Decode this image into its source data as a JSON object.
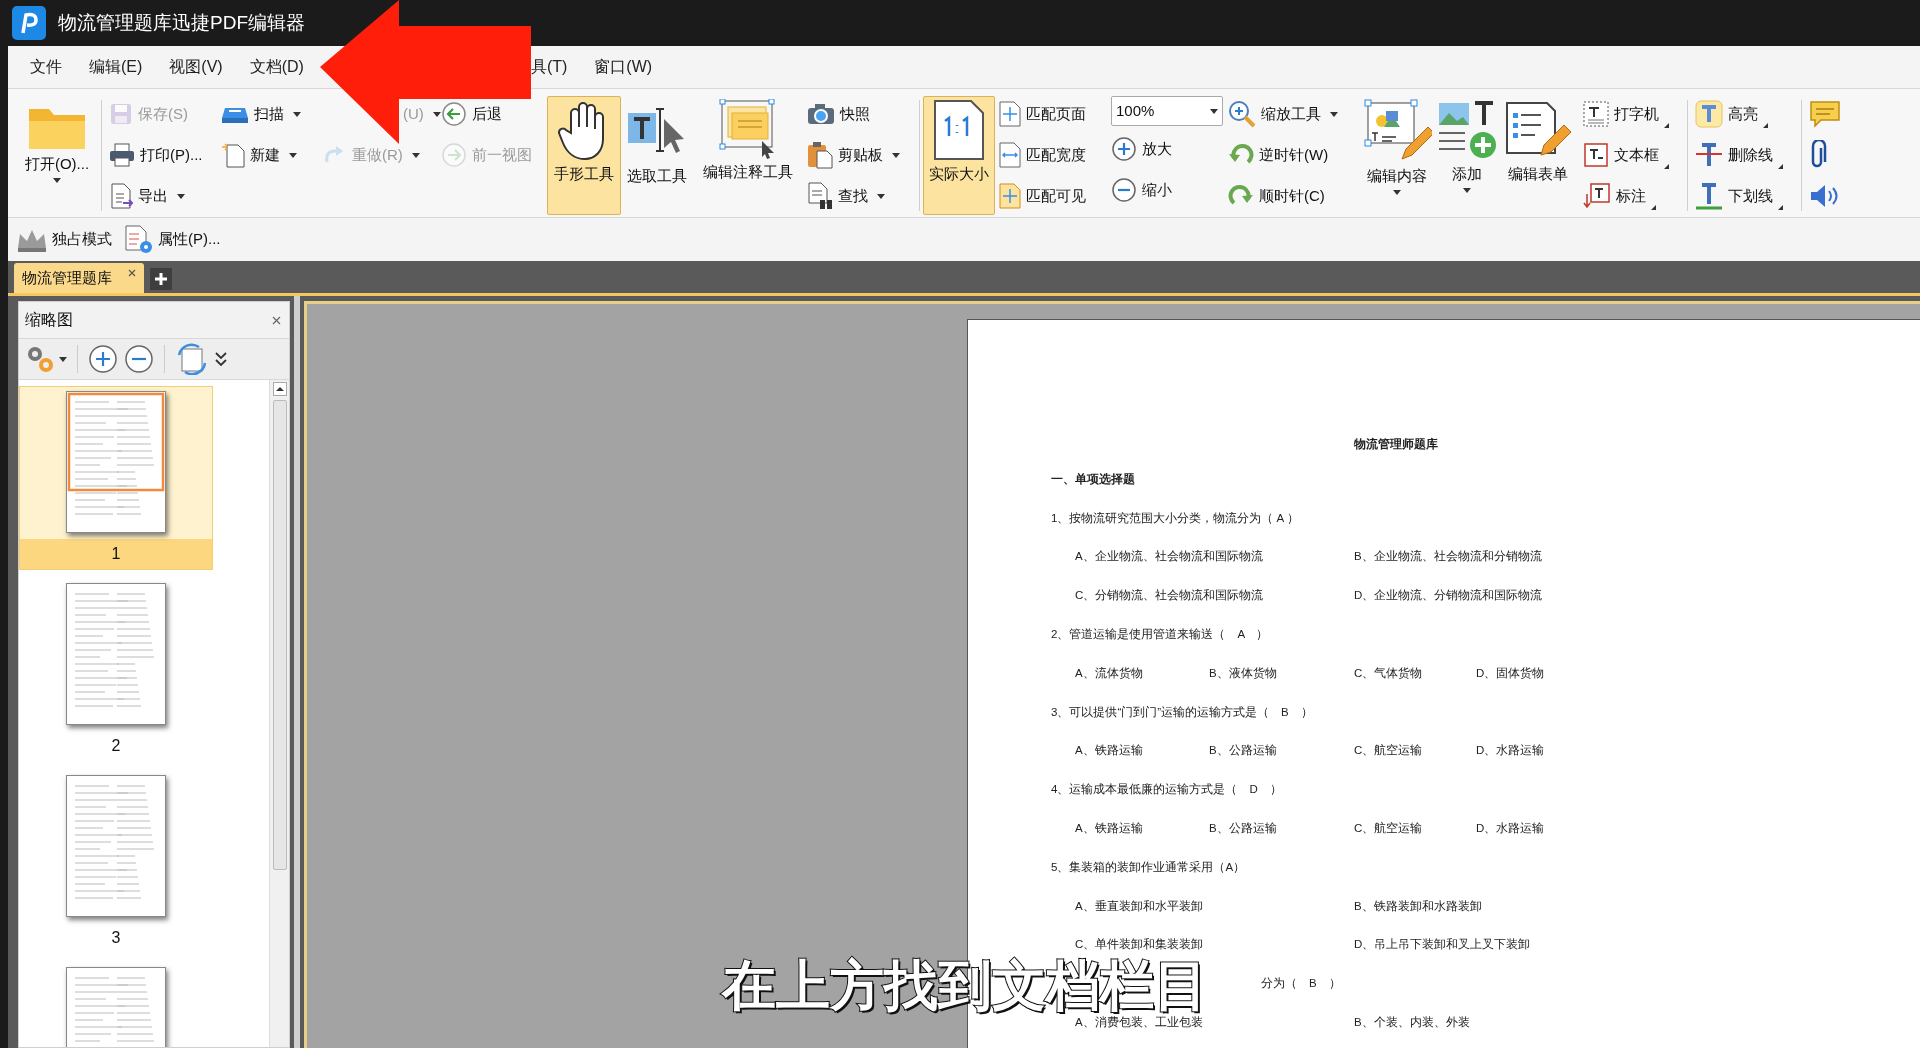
{
  "window": {
    "title": "物流管理题库迅捷PDF编辑器"
  },
  "menu": [
    {
      "label": "文件"
    },
    {
      "label": "编辑(E)"
    },
    {
      "label": "视图(V)"
    },
    {
      "label": "文档(D)"
    },
    {
      "label": "具(T)"
    },
    {
      "label": "窗口(W)"
    }
  ],
  "ribbon": {
    "columns": [
      {
        "kind": "large",
        "items": [
          {
            "label": "打开(O)...",
            "dropdown": true,
            "selected": false
          }
        ],
        "separator_after": true
      },
      {
        "kind": "stack",
        "items": [
          {
            "label": "保存(S)",
            "disabled": true
          },
          {
            "label": "打印(P)...",
            "disabled": false
          },
          {
            "label": "导出",
            "dropdown": true,
            "disabled": false
          }
        ]
      },
      {
        "kind": "stack",
        "items": [
          {
            "label": "扫描",
            "dropdown": true,
            "disabled": false
          },
          {
            "label": "新建",
            "dropdown": true,
            "disabled": false
          }
        ]
      },
      {
        "kind": "stack",
        "items": [
          {
            "kind": "text",
            "label": "(U)",
            "dropdown": true,
            "disabled": true
          },
          {
            "label": "重做(R)",
            "dropdown": true,
            "disabled": true
          }
        ]
      },
      {
        "kind": "stack",
        "items": [
          {
            "label": "后退",
            "disabled": false
          },
          {
            "label": "前一视图",
            "disabled": true
          }
        ]
      },
      {
        "kind": "large",
        "items": [
          {
            "label": "手形工具",
            "selected": true
          },
          {
            "label": "选取工具",
            "selected": false
          },
          {
            "label": "编辑注释工具",
            "selected": false
          }
        ]
      },
      {
        "kind": "stack",
        "items": [
          {
            "label": "快照",
            "disabled": false
          },
          {
            "label": "剪贴板",
            "dropdown": true,
            "disabled": false
          },
          {
            "label": "查找",
            "dropdown": true,
            "disabled": false
          }
        ],
        "separator_after": true
      },
      {
        "kind": "large",
        "items": [
          {
            "label": "实际大小",
            "selected": true
          }
        ]
      },
      {
        "kind": "stack",
        "items": [
          {
            "label": "匹配页面",
            "disabled": false
          },
          {
            "label": "匹配宽度",
            "disabled": false
          },
          {
            "label": "匹配可见",
            "disabled": false
          }
        ]
      },
      {
        "kind": "stack",
        "items": [
          {
            "kind": "select",
            "value": "100%"
          },
          {
            "label": "放大",
            "disabled": false
          },
          {
            "label": "缩小",
            "disabled": false
          }
        ]
      },
      {
        "kind": "stack",
        "items": [
          {
            "label": "缩放工具",
            "dropdown": true,
            "disabled": false
          },
          {
            "label": "逆时针(W)",
            "disabled": false
          },
          {
            "label": "顺时针(C)",
            "disabled": false
          }
        ]
      },
      {
        "kind": "large",
        "items": [
          {
            "label": "编辑内容",
            "dropdown": true,
            "selected": false
          },
          {
            "label": "添加",
            "dropdown": true,
            "selected": false
          },
          {
            "label": "编辑表单",
            "selected": false
          }
        ]
      },
      {
        "kind": "stack",
        "items": [
          {
            "label": "打字机",
            "submenu": true,
            "disabled": false
          },
          {
            "label": "文本框",
            "submenu": true,
            "disabled": false
          },
          {
            "label": "标注",
            "submenu": true,
            "disabled": false
          }
        ],
        "separator_after": true
      },
      {
        "kind": "stack",
        "items": [
          {
            "label": "高亮",
            "submenu": true,
            "disabled": false
          },
          {
            "label": "删除线",
            "submenu": true,
            "disabled": false
          },
          {
            "label": "下划线",
            "submenu": true,
            "disabled": false
          }
        ],
        "separator_after": true
      },
      {
        "kind": "stack",
        "items": [
          {
            "kind": "icon"
          },
          {
            "kind": "icon"
          },
          {
            "kind": "icon"
          }
        ]
      }
    ]
  },
  "quick_bar": [
    {
      "label": "独占模式"
    },
    {
      "label": "属性(P)..."
    }
  ],
  "tabs": [
    {
      "label": "物流管理题库",
      "selected": true
    }
  ],
  "thumbnails_panel": {
    "title": "缩略图",
    "pages": [
      {
        "label": "1",
        "selected": true
      },
      {
        "label": "2",
        "selected": false
      },
      {
        "label": "3",
        "selected": false
      },
      {
        "selected": false
      }
    ]
  },
  "document": {
    "title": "物流管理师题库",
    "lines": [
      {
        "kind": "heading",
        "text": "一、单项选择题"
      },
      {
        "kind": "question",
        "text": "1、按物流研究范围大小分类，物流分为（ A ）"
      },
      {
        "kind": "options",
        "items": [
          "A、企业物流、社会物流和国际物流",
          "B、企业物流、社会物流和分销物流"
        ]
      },
      {
        "kind": "options",
        "items": [
          "C、分销物流、社会物流和国际物流",
          "D、企业物流、分销物流和国际物流"
        ]
      },
      {
        "kind": "question",
        "text": "2、管道运输是使用管道来输送（　A　）"
      },
      {
        "kind": "options",
        "items": [
          "A、流体货物",
          "B、液体货物",
          "C、气体货物",
          "D、固体货物"
        ]
      },
      {
        "kind": "question",
        "text": "3、可以提供“门到门”运输的运输方式是（　B　）"
      },
      {
        "kind": "options",
        "items": [
          "A、铁路运输",
          "B、公路运输",
          "C、航空运输",
          "D、水路运输"
        ]
      },
      {
        "kind": "question",
        "text": "4、运输成本最低廉的运输方式是（　D　）"
      },
      {
        "kind": "options",
        "items": [
          "A、铁路运输",
          "B、公路运输",
          "C、航空运输",
          "D、水路运输"
        ]
      },
      {
        "kind": "question",
        "text": "5、集装箱的装卸作业通常采用（A）"
      },
      {
        "kind": "options",
        "items": [
          "A、垂直装卸和水平装卸",
          "B、铁路装卸和水路装卸"
        ]
      },
      {
        "kind": "options",
        "items": [
          "C、单件装卸和集装装卸",
          "D、吊上吊下装卸和叉上叉下装卸"
        ]
      },
      {
        "kind": "fragment",
        "text": "分为（　B　）"
      },
      {
        "kind": "options",
        "items": [
          "A、消费包装、工业包装",
          "B、个装、内装、外装"
        ]
      }
    ]
  },
  "caption": "在上方找到文档栏目"
}
